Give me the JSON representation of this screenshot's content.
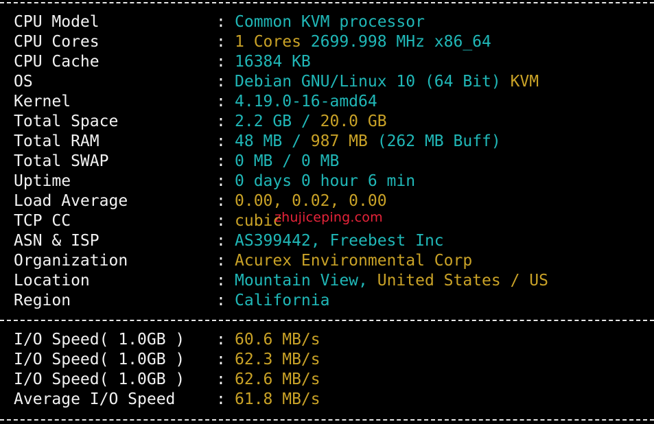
{
  "system_info": [
    {
      "label": "CPU Model",
      "colon": ":",
      "segments": [
        {
          "text": "Common KVM processor",
          "color": "cyan"
        }
      ]
    },
    {
      "label": "CPU Cores",
      "colon": ":",
      "segments": [
        {
          "text": "1 Cores ",
          "color": "yellow"
        },
        {
          "text": "2699.998 MHz x86_64",
          "color": "cyan"
        }
      ]
    },
    {
      "label": "CPU Cache",
      "colon": ":",
      "segments": [
        {
          "text": "16384 KB",
          "color": "cyan"
        }
      ]
    },
    {
      "label": "OS",
      "colon": ":",
      "segments": [
        {
          "text": "Debian GNU/Linux 10 (64 Bit) ",
          "color": "cyan"
        },
        {
          "text": "KVM",
          "color": "yellow"
        }
      ]
    },
    {
      "label": "Kernel",
      "colon": ":",
      "segments": [
        {
          "text": "4.19.0-16-amd64",
          "color": "cyan"
        }
      ]
    },
    {
      "label": "Total Space",
      "colon": ":",
      "segments": [
        {
          "text": "2.2 GB / ",
          "color": "cyan"
        },
        {
          "text": "20.0 GB",
          "color": "yellow"
        }
      ]
    },
    {
      "label": "Total RAM",
      "colon": ":",
      "segments": [
        {
          "text": "48 MB / ",
          "color": "cyan"
        },
        {
          "text": "987 MB",
          "color": "yellow"
        },
        {
          "text": " (262 MB Buff)",
          "color": "cyan"
        }
      ]
    },
    {
      "label": "Total SWAP",
      "colon": ":",
      "segments": [
        {
          "text": "0 MB / 0 MB",
          "color": "cyan"
        }
      ]
    },
    {
      "label": "Uptime",
      "colon": ":",
      "segments": [
        {
          "text": "0 days 0 hour 6 min",
          "color": "cyan"
        }
      ]
    },
    {
      "label": "Load Average",
      "colon": ":",
      "segments": [
        {
          "text": "0.00, 0.02, 0.00",
          "color": "yellow"
        }
      ]
    },
    {
      "label": "TCP CC",
      "colon": ":",
      "segments": [
        {
          "text": "cubic",
          "color": "yellow"
        }
      ]
    },
    {
      "label": "ASN & ISP",
      "colon": ":",
      "segments": [
        {
          "text": "AS399442, Freebest Inc",
          "color": "cyan"
        }
      ]
    },
    {
      "label": "Organization",
      "colon": ":",
      "segments": [
        {
          "text": "Acurex Environmental Corp",
          "color": "yellow"
        }
      ]
    },
    {
      "label": "Location",
      "colon": ":",
      "segments": [
        {
          "text": "Mountain View, ",
          "color": "cyan"
        },
        {
          "text": "United States / US",
          "color": "yellow"
        }
      ]
    },
    {
      "label": "Region",
      "colon": ":",
      "segments": [
        {
          "text": "California",
          "color": "cyan"
        }
      ]
    }
  ],
  "io_info": [
    {
      "label": "I/O Speed( 1.0GB )",
      "colon": ":",
      "segments": [
        {
          "text": "60.6 MB/s",
          "color": "yellow"
        }
      ]
    },
    {
      "label": "I/O Speed( 1.0GB )",
      "colon": ":",
      "segments": [
        {
          "text": "62.3 MB/s",
          "color": "yellow"
        }
      ]
    },
    {
      "label": "I/O Speed( 1.0GB )",
      "colon": ":",
      "segments": [
        {
          "text": "62.6 MB/s",
          "color": "yellow"
        }
      ]
    },
    {
      "label": "Average I/O Speed",
      "colon": ":",
      "segments": [
        {
          "text": "61.8 MB/s",
          "color": "yellow"
        }
      ]
    }
  ],
  "watermark": "zhujiceping.com",
  "colors": {
    "background": "#000000",
    "label": "#f2f2f2",
    "cyan": "#20b7b7",
    "yellow": "#c9a227",
    "watermark": "#e8243a"
  }
}
